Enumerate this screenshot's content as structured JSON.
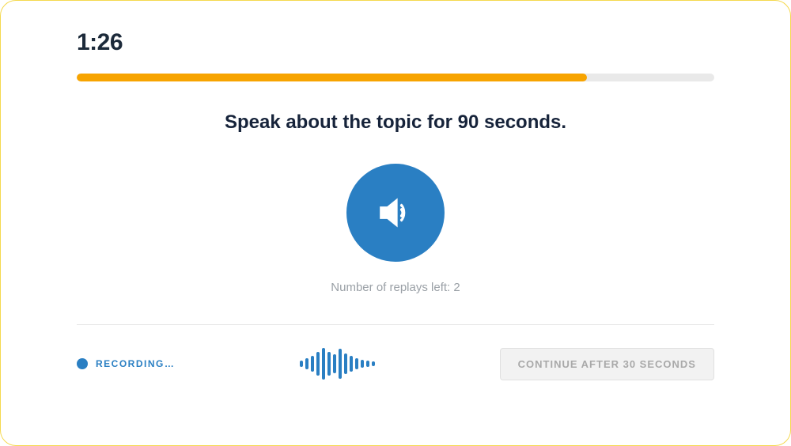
{
  "timer": "1:26",
  "progress_percent": 80,
  "prompt_text": "Speak about the topic for 90 seconds.",
  "replays_text": "Number of replays left: 2",
  "recording_label": "RECORDING…",
  "continue_label": "CONTINUE AFTER 30 SECONDS",
  "colors": {
    "accent_blue": "#2a7fc3",
    "accent_orange": "#f7a401",
    "border_yellow": "#f5d94f"
  },
  "waveform_heights": [
    8,
    14,
    20,
    30,
    40,
    30,
    24,
    38,
    26,
    20,
    14,
    10,
    8,
    6
  ]
}
